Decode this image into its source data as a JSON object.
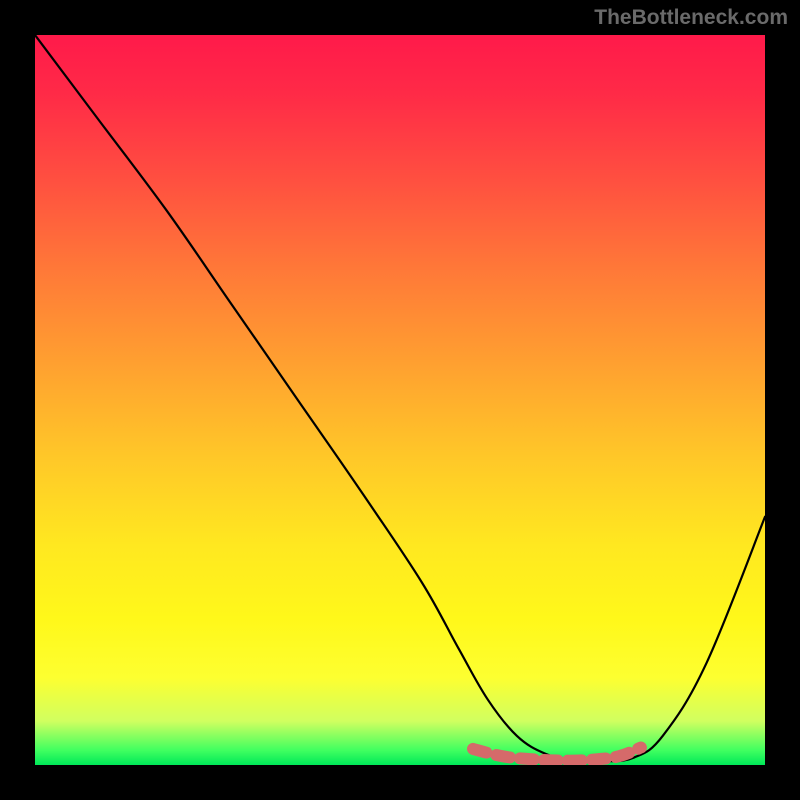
{
  "watermark": "TheBottleneck.com",
  "chart_data": {
    "type": "line",
    "title": "",
    "xlabel": "",
    "ylabel": "",
    "xlim": [
      0,
      100
    ],
    "ylim": [
      0,
      100
    ],
    "series": [
      {
        "name": "bottleneck-curve",
        "x": [
          0,
          9,
          18,
          27,
          36,
          45,
          53,
          58,
          62,
          66,
          70,
          74,
          78,
          82,
          86,
          92,
          100
        ],
        "values": [
          100,
          88,
          76,
          63,
          50,
          37,
          25,
          16,
          9,
          4,
          1.5,
          0.5,
          0.5,
          1,
          4,
          14,
          34
        ]
      },
      {
        "name": "highlight-segment",
        "x": [
          60,
          64,
          68,
          72,
          76,
          80,
          83
        ],
        "values": [
          2.2,
          1.2,
          0.8,
          0.6,
          0.7,
          1.2,
          2.4
        ]
      }
    ],
    "gradient_stops": [
      {
        "pos": 0,
        "color": "#ff1a4a"
      },
      {
        "pos": 20,
        "color": "#ff5040"
      },
      {
        "pos": 45,
        "color": "#ffa030"
      },
      {
        "pos": 70,
        "color": "#ffe820"
      },
      {
        "pos": 88,
        "color": "#fdff30"
      },
      {
        "pos": 98,
        "color": "#40ff60"
      },
      {
        "pos": 100,
        "color": "#00e858"
      }
    ]
  }
}
